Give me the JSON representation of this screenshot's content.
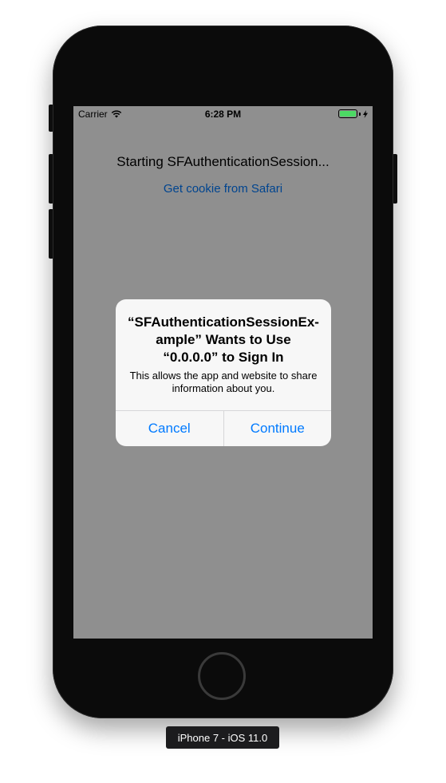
{
  "status_bar": {
    "carrier": "Carrier",
    "time": "6:28 PM",
    "icons": [
      "wifi-icon",
      "battery-icon",
      "charging-bolt-icon"
    ],
    "battery_color": "#4cd964"
  },
  "screen": {
    "title": "Starting SFAuthenticationSession...",
    "link": "Get cookie from Safari"
  },
  "alert": {
    "title": "“SFAuthenticationSessionEx-ample” Wants to Use “0.0.0.0” to Sign In",
    "message": "This allows the app and website to share information about you.",
    "cancel_label": "Cancel",
    "continue_label": "Continue"
  },
  "device": {
    "label": "iPhone 7 - iOS 11.0"
  },
  "colors": {
    "accent": "#007aff",
    "dim_overlay": "rgba(0,0,0,0.44)"
  }
}
